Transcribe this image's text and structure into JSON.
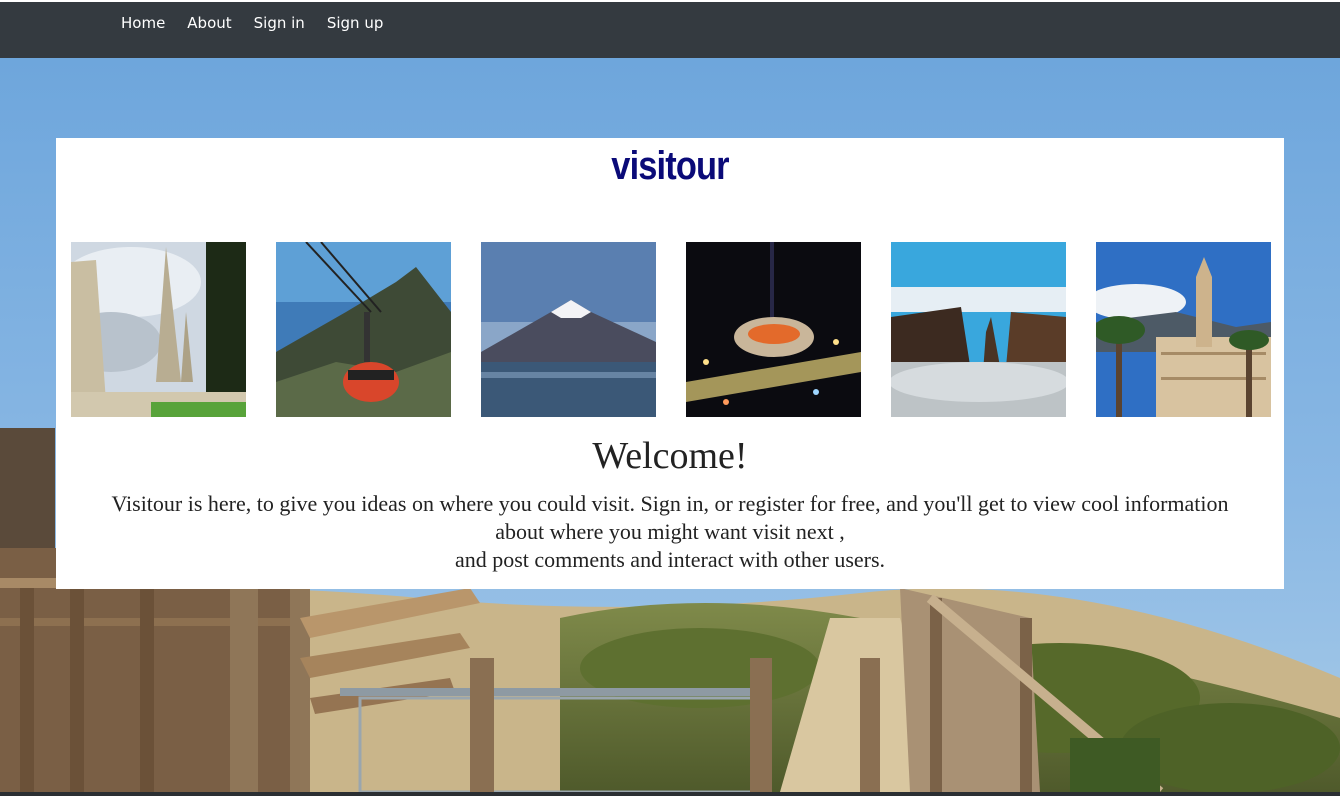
{
  "nav": {
    "items": [
      {
        "label": "Home"
      },
      {
        "label": "About"
      },
      {
        "label": "Sign in"
      },
      {
        "label": "Sign up"
      }
    ]
  },
  "card": {
    "brand": "visitour",
    "welcome": "Welcome!",
    "intro_lines": [
      "Visitour is here, to give you ideas on where you could visit. Sign in, or register for free, and you'll get to view cool information",
      "about where you might want visit next ,",
      "and post comments and interact with other users."
    ]
  },
  "gallery": [
    {
      "subject": "language-monument"
    },
    {
      "subject": "table-mountain-cable-car"
    },
    {
      "subject": "snow-capped-volcano"
    },
    {
      "subject": "stadium-at-night"
    },
    {
      "subject": "cliffs-above-clouds"
    },
    {
      "subject": "city-hall-with-palms"
    }
  ],
  "colors": {
    "navbar": "#343a40",
    "nav_text": "#ffffff",
    "brand": "#0a0a78",
    "body_text": "#222222",
    "card_bg": "#ffffff"
  }
}
